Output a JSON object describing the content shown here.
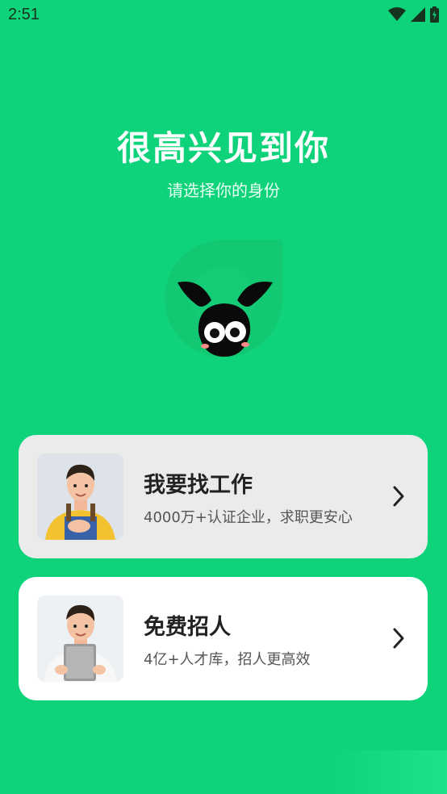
{
  "status_bar": {
    "time": "2:51"
  },
  "header": {
    "title": "很高兴见到你",
    "subtitle": "请选择你的身份"
  },
  "cards": [
    {
      "title": "我要找工作",
      "description": "4000万+认证企业，求职更安心",
      "icon": "chevron-right-icon"
    },
    {
      "title": "免费招人",
      "description": "4亿+人才库，招人更高效",
      "icon": "chevron-right-icon"
    }
  ],
  "colors": {
    "background": "#0fd37a",
    "card_selected": "#ebebeb",
    "card_default": "#ffffff"
  }
}
